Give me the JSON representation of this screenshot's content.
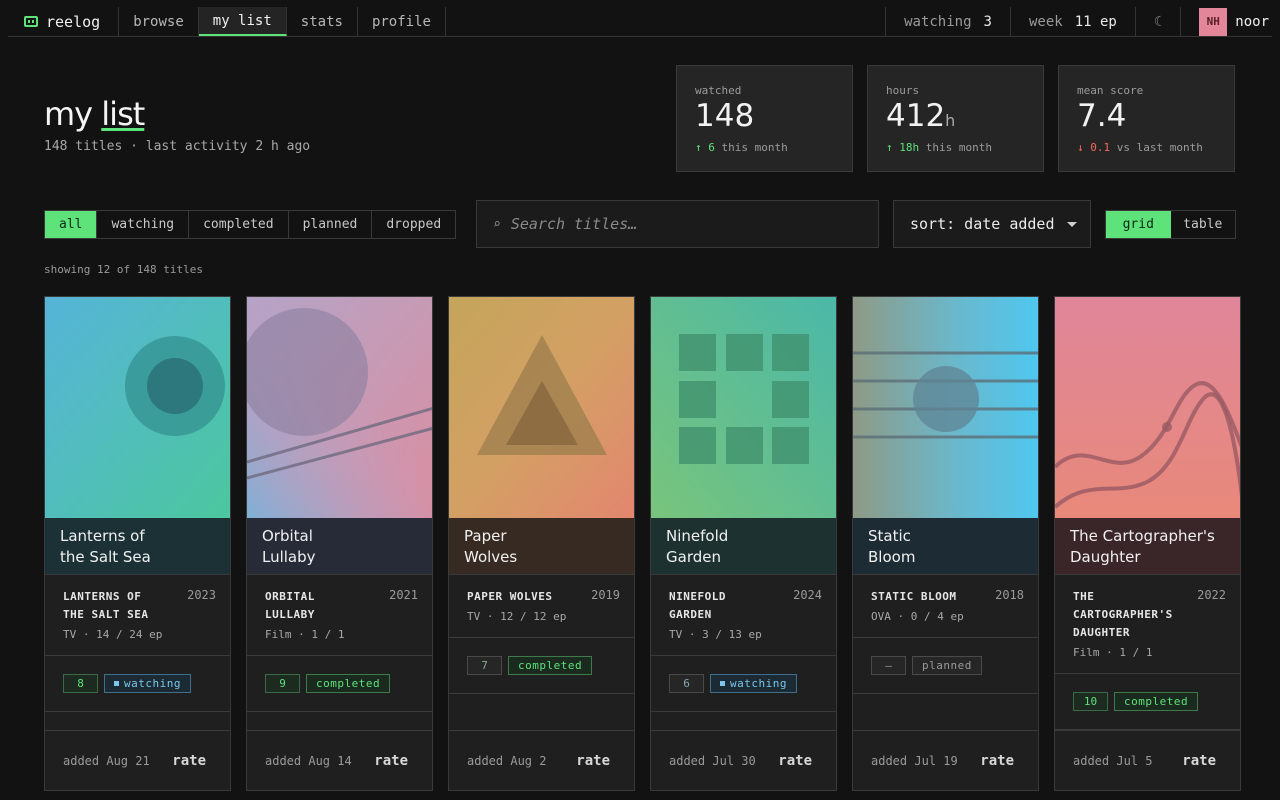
{
  "nav": {
    "brand": "reelog",
    "tabs": [
      "browse",
      "my list",
      "stats",
      "profile"
    ],
    "watching_label": "watching",
    "watching_value": "3",
    "week_label": "week",
    "week_value": "11 ep",
    "theme_glyph": "☾",
    "avatar_initials": "NH",
    "username": "noor"
  },
  "header": {
    "title_a": "my ",
    "title_b": "list",
    "subtitle": "148 titles · last activity 2 h ago"
  },
  "summary": [
    {
      "label": "watched",
      "value": "148",
      "unit": "",
      "arrow": "↑",
      "delta": "6",
      "delta_text": " this month"
    },
    {
      "label": "hours",
      "value": "412",
      "unit": "h",
      "arrow": "↑",
      "delta": "18h",
      "delta_text": " this month"
    },
    {
      "label": "mean score",
      "value": "7.4",
      "unit": "",
      "arrow": "↓",
      "delta": "0.1",
      "delta_text": " vs last month"
    }
  ],
  "filters": [
    "all",
    "watching",
    "completed",
    "planned",
    "dropped"
  ],
  "search": {
    "icon": "⌕",
    "placeholder": "Search titles…"
  },
  "sort": {
    "label": "sort: date added"
  },
  "view": [
    "grid",
    "table"
  ],
  "showing": "showing 12 of 148 titles",
  "cards": [
    {
      "caption_1": "Lanterns of",
      "caption_2": "the Salt Sea",
      "title_1": "LANTERNS OF",
      "title_2": "THE SALT SEA",
      "title_3": "",
      "year": "2023",
      "format": "TV · 14 / 24 ep",
      "score": "8",
      "status": "watching",
      "added": "added Aug 21",
      "rate": "rate"
    },
    {
      "caption_1": "Orbital",
      "caption_2": "Lullaby",
      "title_1": "ORBITAL",
      "title_2": "LULLABY",
      "title_3": "",
      "year": "2021",
      "format": "Film · 1 / 1",
      "score": "9",
      "status": "completed",
      "added": "added Aug 14",
      "rate": "rate"
    },
    {
      "caption_1": "Paper",
      "caption_2": "Wolves",
      "title_1": "PAPER WOLVES",
      "title_2": "",
      "title_3": "",
      "year": "2019",
      "format": "TV · 12 / 12 ep",
      "score": "7",
      "status": "completed",
      "added": "added Aug 2",
      "rate": "rate"
    },
    {
      "caption_1": "Ninefold",
      "caption_2": "Garden",
      "title_1": "NINEFOLD",
      "title_2": "GARDEN",
      "title_3": "",
      "year": "2024",
      "format": "TV · 3 / 13 ep",
      "score": "6",
      "status": "watching",
      "added": "added Jul 30",
      "rate": "rate"
    },
    {
      "caption_1": "Static",
      "caption_2": "Bloom",
      "title_1": "STATIC BLOOM",
      "title_2": "",
      "title_3": "",
      "year": "2018",
      "format": "OVA · 0 / 4 ep",
      "score": "—",
      "status": "planned",
      "added": "added Jul 19",
      "rate": "rate"
    },
    {
      "caption_1": "The Cartographer's",
      "caption_2": "Daughter",
      "title_1": "THE",
      "title_2": "CARTOGRAPHER'S",
      "title_3": "DAUGHTER",
      "year": "2022",
      "format": "Film · 1 / 1",
      "score": "10",
      "status": "completed",
      "added": "added Jul 5",
      "rate": "rate"
    }
  ],
  "colors": {
    "accent": "#5ee27a",
    "watching": "#7cc6ec",
    "down": "#f06a5a",
    "background": "#121212"
  }
}
